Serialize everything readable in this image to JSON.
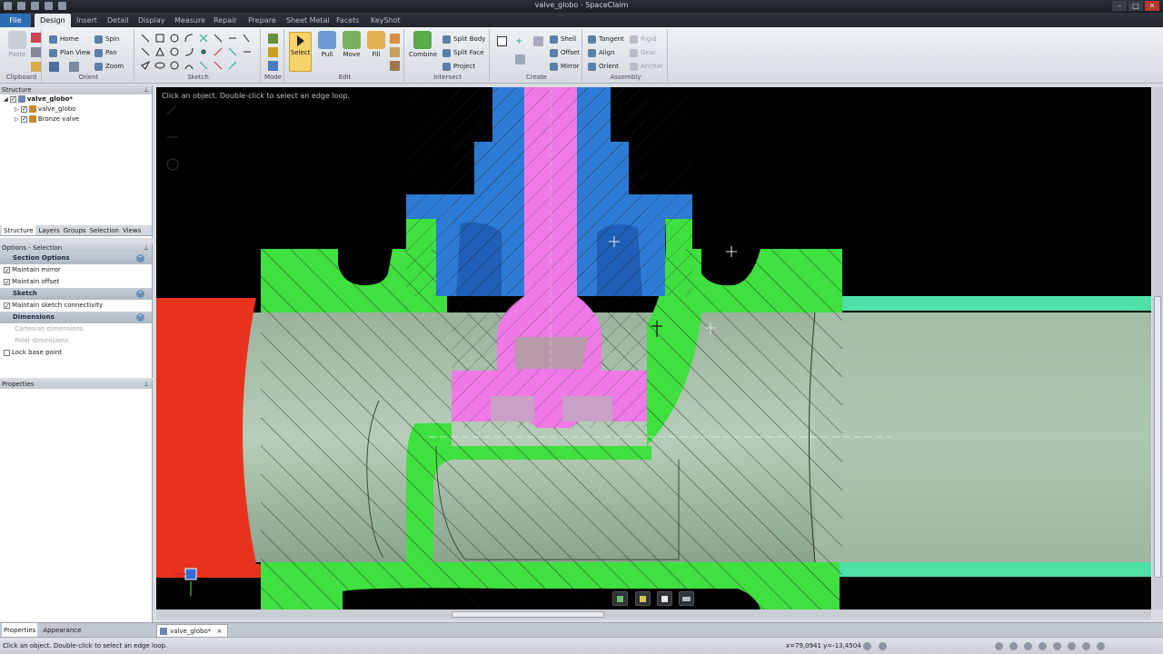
{
  "window": {
    "title": "valve_globo - SpaceClaim"
  },
  "tabs": [
    {
      "label": "File"
    },
    {
      "label": "Design"
    },
    {
      "label": "Insert"
    },
    {
      "label": "Detail"
    },
    {
      "label": "Display"
    },
    {
      "label": "Measure"
    },
    {
      "label": "Repair"
    },
    {
      "label": "Prepare"
    },
    {
      "label": "Sheet Metal"
    },
    {
      "label": "Facets"
    },
    {
      "label": "KeyShot"
    }
  ],
  "ribbon": {
    "clipboard": {
      "label": "Clipboard",
      "paste": "Paste"
    },
    "orient": {
      "label": "Orient",
      "home": "Home",
      "spin": "Spin",
      "plan_view": "Plan View",
      "pan": "Pan",
      "zoom": "Zoom"
    },
    "sketch": {
      "label": "Sketch"
    },
    "mode": {
      "label": "Mode"
    },
    "edit": {
      "label": "Edit",
      "select": "Select",
      "pull": "Pull",
      "move": "Move",
      "fill": "Fill"
    },
    "intersect": {
      "label": "Intersect",
      "combine": "Combine",
      "split_body": "Split Body",
      "split_face": "Split Face",
      "project": "Project"
    },
    "create": {
      "label": "Create",
      "shell": "Shell",
      "offset": "Offset",
      "mirror": "Mirror"
    },
    "assembly": {
      "label": "Assembly",
      "tangent": "Tangent",
      "align": "Align",
      "orient": "Orient",
      "rigid": "Rigid",
      "gear": "Gear",
      "anchor": "Anchor"
    }
  },
  "structure": {
    "title": "Structure",
    "items": [
      {
        "label": "valve_globo*"
      },
      {
        "label": "valve_globo"
      },
      {
        "label": "Bronze valve"
      }
    ],
    "tabs": [
      "Structure",
      "Layers",
      "Groups",
      "Selection",
      "Views"
    ]
  },
  "options": {
    "title": "Options - Selection",
    "section_options": "Section Options",
    "maintain_mirror": "Maintain mirror",
    "maintain_offset": "Maintain offset",
    "sketch": "Sketch",
    "maintain_sketch": "Maintain sketch connectivity",
    "dimensions": "Dimensions",
    "cartesian": "Cartesian dimensions",
    "polar": "Polar dimensions",
    "lock_base": "Lock base point"
  },
  "properties": {
    "title": "Properties"
  },
  "bottom_tabs": [
    "Properties",
    "Appearance"
  ],
  "viewport": {
    "hint": "Click an object. Double-click to select an edge loop."
  },
  "doc_tab": {
    "label": "valve_globo*"
  },
  "status": {
    "message": "Click an object. Double-click to select an edge loop.",
    "coords": "x=79,0941  y=-13,4504"
  },
  "colors": {
    "body_green": "#3fe03f",
    "stem_pink": "#f07ae8",
    "bonnet_blue": "#2e7bd6",
    "pipe_red": "#e8321e",
    "pipe_teal": "#4fe0a8",
    "interior": "#9db89f"
  }
}
